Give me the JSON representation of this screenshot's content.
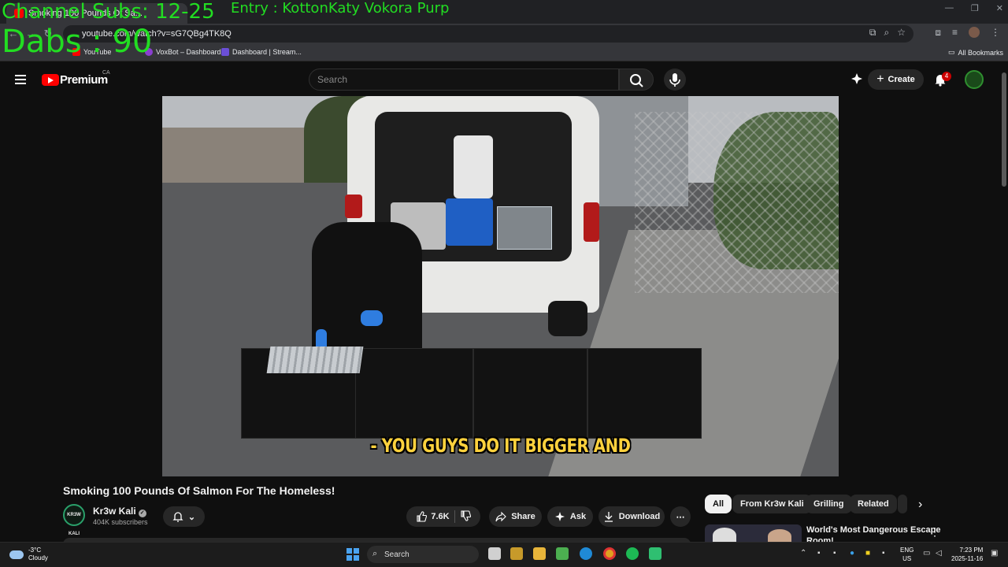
{
  "overlay": {
    "subs": "Channel Subs: 12-25",
    "dabs": "Dabs : 90",
    "entry": "Entry : KottonKaty Vokora Purp"
  },
  "browser": {
    "tab_title": "Smoking 100 Pounds Of Sa...",
    "url": "youtube.com/watch?v=sG7QBg4TK8Q",
    "bookmarks": [
      "YouTube",
      "VoxBot – Dashboard",
      "Dashboard | Stream..."
    ],
    "all_bookmarks": "All Bookmarks"
  },
  "youtube": {
    "logo_text": "Premium",
    "region": "CA",
    "search_placeholder": "Search",
    "create_label": "Create",
    "notif_count": "4"
  },
  "video": {
    "caption": "- YOU GUYS DO IT BIGGER AND",
    "title": "Smoking 100 Pounds Of Salmon For The Homeless!"
  },
  "channel": {
    "logo_text": "KR3W KALI",
    "name": "Kr3w Kali",
    "subscribers": "404K subscribers"
  },
  "actions": {
    "likes": "7.6K",
    "share": "Share",
    "ask": "Ask",
    "download": "Download"
  },
  "chips": [
    "All",
    "From Kr3w Kali",
    "Grilling",
    "Related"
  ],
  "recommended": {
    "title_line1": "World's Most Dangerous Escape",
    "title_line2": "Room!"
  },
  "taskbar": {
    "temp": "-3°C",
    "weather": "Cloudy",
    "search": "Search",
    "lang1": "ENG",
    "lang2": "US",
    "time": "7:23 PM",
    "date": "2025-11-16"
  },
  "colors": {
    "overlay_green": "#22dd22",
    "yt_red": "#ff0000",
    "caption_yellow": "#ffd23d"
  }
}
